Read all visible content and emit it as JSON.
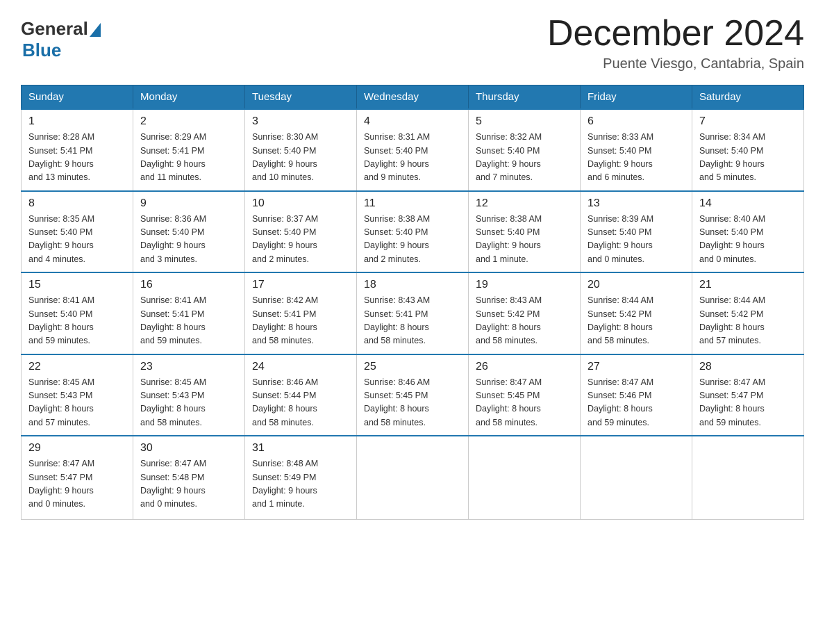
{
  "header": {
    "month_title": "December 2024",
    "location": "Puente Viesgo, Cantabria, Spain",
    "logo_general": "General",
    "logo_blue": "Blue"
  },
  "days_of_week": [
    "Sunday",
    "Monday",
    "Tuesday",
    "Wednesday",
    "Thursday",
    "Friday",
    "Saturday"
  ],
  "weeks": [
    [
      {
        "day": "1",
        "sunrise": "8:28 AM",
        "sunset": "5:41 PM",
        "daylight": "9 hours and 13 minutes."
      },
      {
        "day": "2",
        "sunrise": "8:29 AM",
        "sunset": "5:41 PM",
        "daylight": "9 hours and 11 minutes."
      },
      {
        "day": "3",
        "sunrise": "8:30 AM",
        "sunset": "5:40 PM",
        "daylight": "9 hours and 10 minutes."
      },
      {
        "day": "4",
        "sunrise": "8:31 AM",
        "sunset": "5:40 PM",
        "daylight": "9 hours and 9 minutes."
      },
      {
        "day": "5",
        "sunrise": "8:32 AM",
        "sunset": "5:40 PM",
        "daylight": "9 hours and 7 minutes."
      },
      {
        "day": "6",
        "sunrise": "8:33 AM",
        "sunset": "5:40 PM",
        "daylight": "9 hours and 6 minutes."
      },
      {
        "day": "7",
        "sunrise": "8:34 AM",
        "sunset": "5:40 PM",
        "daylight": "9 hours and 5 minutes."
      }
    ],
    [
      {
        "day": "8",
        "sunrise": "8:35 AM",
        "sunset": "5:40 PM",
        "daylight": "9 hours and 4 minutes."
      },
      {
        "day": "9",
        "sunrise": "8:36 AM",
        "sunset": "5:40 PM",
        "daylight": "9 hours and 3 minutes."
      },
      {
        "day": "10",
        "sunrise": "8:37 AM",
        "sunset": "5:40 PM",
        "daylight": "9 hours and 2 minutes."
      },
      {
        "day": "11",
        "sunrise": "8:38 AM",
        "sunset": "5:40 PM",
        "daylight": "9 hours and 2 minutes."
      },
      {
        "day": "12",
        "sunrise": "8:38 AM",
        "sunset": "5:40 PM",
        "daylight": "9 hours and 1 minute."
      },
      {
        "day": "13",
        "sunrise": "8:39 AM",
        "sunset": "5:40 PM",
        "daylight": "9 hours and 0 minutes."
      },
      {
        "day": "14",
        "sunrise": "8:40 AM",
        "sunset": "5:40 PM",
        "daylight": "9 hours and 0 minutes."
      }
    ],
    [
      {
        "day": "15",
        "sunrise": "8:41 AM",
        "sunset": "5:40 PM",
        "daylight": "8 hours and 59 minutes."
      },
      {
        "day": "16",
        "sunrise": "8:41 AM",
        "sunset": "5:41 PM",
        "daylight": "8 hours and 59 minutes."
      },
      {
        "day": "17",
        "sunrise": "8:42 AM",
        "sunset": "5:41 PM",
        "daylight": "8 hours and 58 minutes."
      },
      {
        "day": "18",
        "sunrise": "8:43 AM",
        "sunset": "5:41 PM",
        "daylight": "8 hours and 58 minutes."
      },
      {
        "day": "19",
        "sunrise": "8:43 AM",
        "sunset": "5:42 PM",
        "daylight": "8 hours and 58 minutes."
      },
      {
        "day": "20",
        "sunrise": "8:44 AM",
        "sunset": "5:42 PM",
        "daylight": "8 hours and 58 minutes."
      },
      {
        "day": "21",
        "sunrise": "8:44 AM",
        "sunset": "5:42 PM",
        "daylight": "8 hours and 57 minutes."
      }
    ],
    [
      {
        "day": "22",
        "sunrise": "8:45 AM",
        "sunset": "5:43 PM",
        "daylight": "8 hours and 57 minutes."
      },
      {
        "day": "23",
        "sunrise": "8:45 AM",
        "sunset": "5:43 PM",
        "daylight": "8 hours and 58 minutes."
      },
      {
        "day": "24",
        "sunrise": "8:46 AM",
        "sunset": "5:44 PM",
        "daylight": "8 hours and 58 minutes."
      },
      {
        "day": "25",
        "sunrise": "8:46 AM",
        "sunset": "5:45 PM",
        "daylight": "8 hours and 58 minutes."
      },
      {
        "day": "26",
        "sunrise": "8:47 AM",
        "sunset": "5:45 PM",
        "daylight": "8 hours and 58 minutes."
      },
      {
        "day": "27",
        "sunrise": "8:47 AM",
        "sunset": "5:46 PM",
        "daylight": "8 hours and 59 minutes."
      },
      {
        "day": "28",
        "sunrise": "8:47 AM",
        "sunset": "5:47 PM",
        "daylight": "8 hours and 59 minutes."
      }
    ],
    [
      {
        "day": "29",
        "sunrise": "8:47 AM",
        "sunset": "5:47 PM",
        "daylight": "9 hours and 0 minutes."
      },
      {
        "day": "30",
        "sunrise": "8:47 AM",
        "sunset": "5:48 PM",
        "daylight": "9 hours and 0 minutes."
      },
      {
        "day": "31",
        "sunrise": "8:48 AM",
        "sunset": "5:49 PM",
        "daylight": "9 hours and 1 minute."
      },
      null,
      null,
      null,
      null
    ]
  ],
  "labels": {
    "sunrise": "Sunrise:",
    "sunset": "Sunset:",
    "daylight": "Daylight:"
  }
}
